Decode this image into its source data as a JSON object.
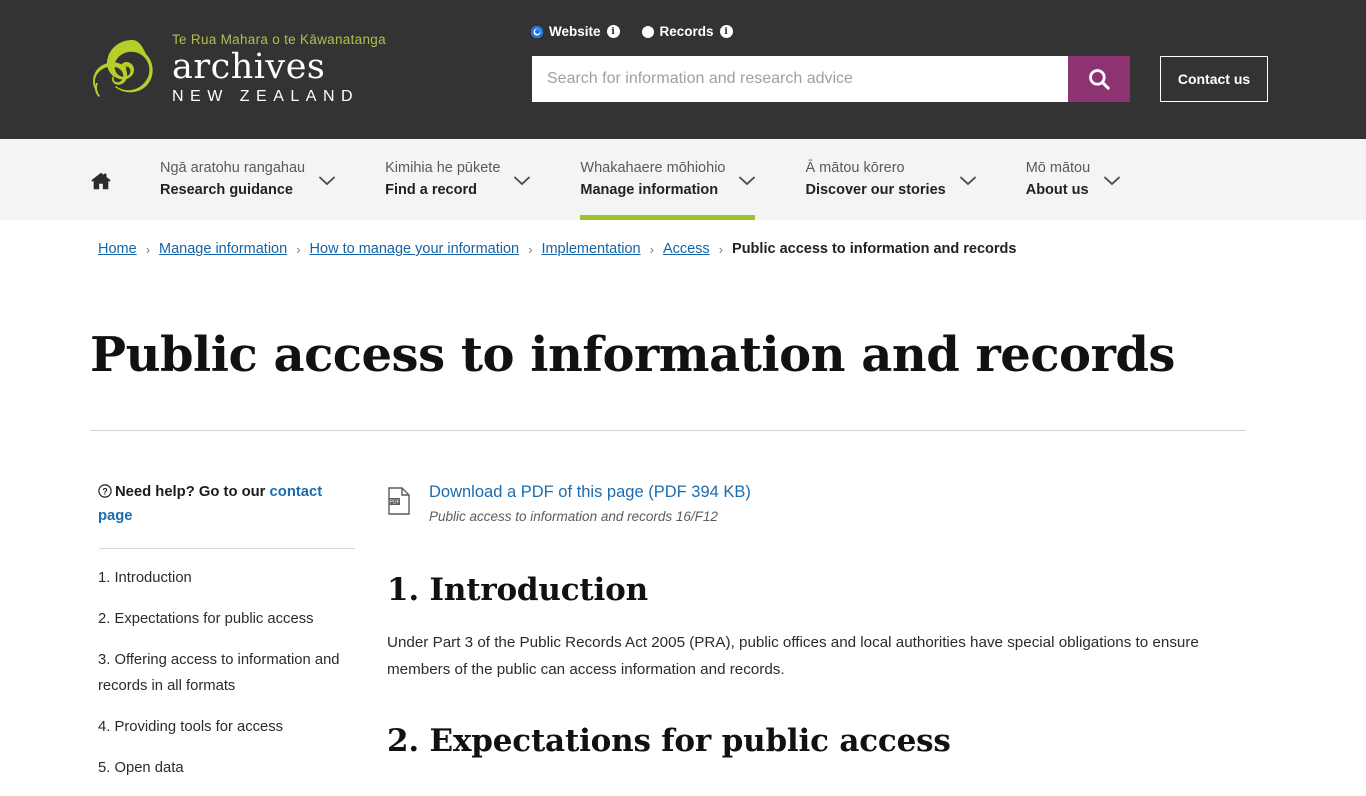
{
  "brand": {
    "tagline": "Te Rua Mahara o te Kāwanatanga",
    "name": "archives",
    "country": "NEW ZEALAND",
    "logo_color": "#b8cc2a",
    "header_bg": "#333333"
  },
  "search": {
    "modes": [
      {
        "label": "Website",
        "selected": true,
        "info": "i"
      },
      {
        "label": "Records",
        "selected": false,
        "info": "i"
      }
    ],
    "placeholder": "Search for information and research advice",
    "value": "",
    "button_icon": "search-icon",
    "button_color": "#8d3372"
  },
  "contact": {
    "label": "Contact us"
  },
  "nav": {
    "home_icon": "home-icon",
    "items": [
      {
        "mi": "Ngā aratohu rangahau",
        "en": "Research guidance",
        "active": false
      },
      {
        "mi": "Kimihia he pūkete",
        "en": "Find a record",
        "active": false
      },
      {
        "mi": "Whakahaere mōhiohio",
        "en": "Manage information",
        "active": true
      },
      {
        "mi": "Ā mātou kōrero",
        "en": "Discover our stories",
        "active": false
      },
      {
        "mi": "Mō mātou",
        "en": "About us",
        "active": false
      }
    ],
    "active_color": "#9cc22c"
  },
  "breadcrumb": {
    "separator": "›",
    "items": [
      {
        "label": "Home",
        "current": false
      },
      {
        "label": "Manage information",
        "current": false
      },
      {
        "label": "How to manage your information",
        "current": false
      },
      {
        "label": "Implementation",
        "current": false
      },
      {
        "label": "Access",
        "current": false
      },
      {
        "label": "Public access to information and records",
        "current": true
      }
    ]
  },
  "page": {
    "title": "Public access to information and records"
  },
  "sidebar": {
    "help_prefix": "Need help? Go to our ",
    "help_link": "contact page",
    "toc": [
      {
        "label": "1. Introduction"
      },
      {
        "label": "2. Expectations for public access"
      },
      {
        "label": "3. Offering access to information and records in all formats"
      },
      {
        "label": "4. Providing tools for access"
      },
      {
        "label": "5. Open data"
      }
    ]
  },
  "main": {
    "pdf": {
      "link": "Download a PDF of this page (PDF 394 KB)",
      "subtitle": "Public access to information and records 16/F12",
      "icon": "pdf-file-icon"
    },
    "sections": [
      {
        "heading": "1. Introduction",
        "paragraph": "Under Part 3 of the Public Records Act 2005 (PRA), public offices and local authorities have special obligations to ensure members of the public can access information and records."
      },
      {
        "heading": "2. Expectations for public access",
        "paragraph": ""
      }
    ]
  }
}
